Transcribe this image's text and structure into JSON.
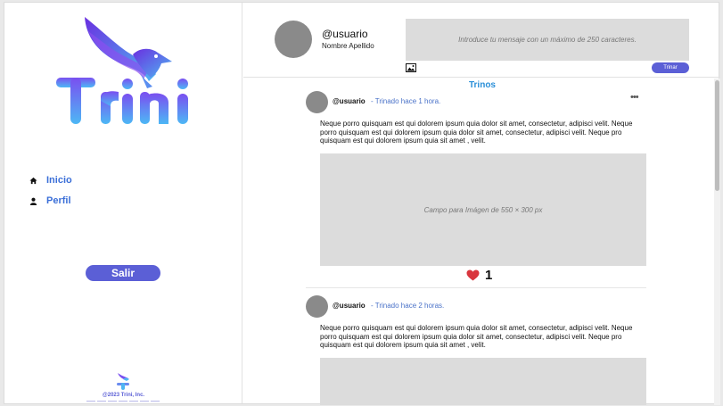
{
  "brand": {
    "name": "Trini"
  },
  "sidebar": {
    "items": [
      {
        "label": "Inicio",
        "icon": "home-icon"
      },
      {
        "label": "Perfil",
        "icon": "user-icon"
      }
    ],
    "logout_label": "Salir",
    "copyright": "@2023 Trini, Inc."
  },
  "composer": {
    "username": "@usuario",
    "full_name": "Nombre Apellido",
    "placeholder": "Introduce tu mensaje con un máximo de 250 caracteres.",
    "submit_label": "Trinar",
    "image_icon": "image-icon"
  },
  "feed": {
    "tab_label": "Trinos",
    "posts": [
      {
        "user": "@usuario",
        "time": "- Trinado hace 1 hora.",
        "body": "Neque porro quisquam est qui dolorem ipsum quia dolor sit amet, consectetur, adipisci velit. Neque porro quisquam est qui dolorem ipsum quia dolor sit amet, consectetur, adipisci velit. Neque pro quisquam est qui dolorem ipsum quia sit amet , velit.",
        "image_placeholder": "Campo para Imágen de 550 × 300 px",
        "likes": "1"
      },
      {
        "user": "@usuario",
        "time": "- Trinado hace 2 horas.",
        "body": "Neque porro quisquam est qui dolorem ipsum quia dolor sit amet, consectetur, adipisci velit. Neque porro quisquam est qui dolorem ipsum quia dolor sit amet, consectetur, adipisci velit. Neque pro quisquam est qui dolorem ipsum quia sit amet , velit."
      }
    ]
  },
  "colors": {
    "accent": "#5b5fd6",
    "link": "#3b6fd8",
    "heart": "#d9363e",
    "tab": "#2aa3e0"
  }
}
